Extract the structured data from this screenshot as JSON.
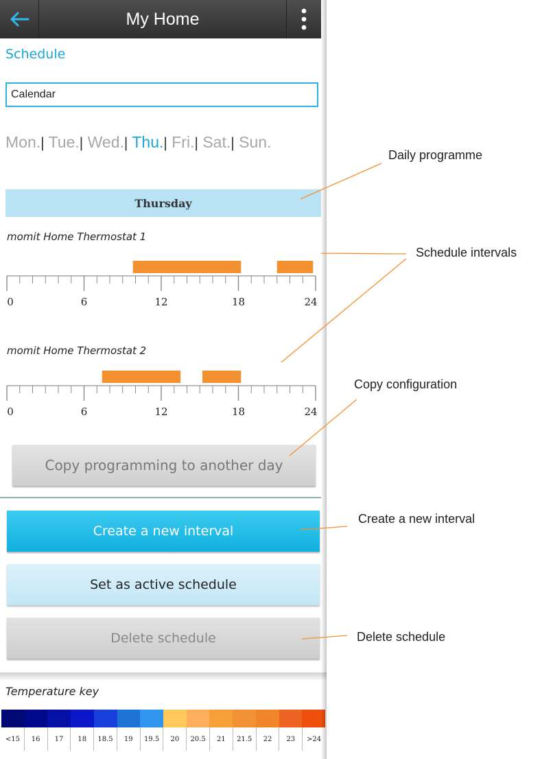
{
  "appbar": {
    "title": "My Home",
    "back_icon": "arrow-left-icon",
    "menu_icon": "more-vertical-icon"
  },
  "schedule": {
    "section_title": "Schedule",
    "calendar_value": "Calendar",
    "days": [
      "Mon.",
      "Tue.",
      "Wed.",
      "Thu.",
      "Fri.",
      "Sat.",
      "Sun."
    ],
    "separators": [
      "|",
      "|",
      "|",
      "|",
      "|",
      "|"
    ],
    "active_day": "Thu.",
    "selected_day_title": "Thursday"
  },
  "thermostats": [
    {
      "name": "momit Home Thermostat 1",
      "intervals": [
        [
          9.8,
          18.2
        ],
        [
          21.0,
          23.8
        ]
      ],
      "axis_labels": [
        "0",
        "6",
        "12",
        "18",
        "24"
      ]
    },
    {
      "name": "momit Home Thermostat 2",
      "intervals": [
        [
          7.4,
          13.5
        ],
        [
          15.2,
          18.2
        ]
      ],
      "axis_labels": [
        "0",
        "6",
        "12",
        "18",
        "24"
      ]
    }
  ],
  "buttons": {
    "copy": "Copy programming to another day",
    "create": "Create a new interval",
    "set_active": "Set as active schedule",
    "delete": "Delete schedule"
  },
  "temperature_key": {
    "title": "Temperature key",
    "labels": [
      "<15",
      "16",
      "17",
      "18",
      "18.5",
      "19",
      "19.5",
      "20",
      "20.5",
      "21",
      "21.5",
      "22",
      "23",
      ">24"
    ],
    "colors": [
      "#000873",
      "#00088c",
      "#0511a6",
      "#0a16c7",
      "#1640d9",
      "#1d73d6",
      "#2f95ee",
      "#ffc85a",
      "#ffaf5a",
      "#f7a03a",
      "#f39137",
      "#f1852a",
      "#ef6322",
      "#ee4f0c"
    ]
  },
  "annotations": {
    "daily_programme": "Daily programme",
    "schedule_intervals": "Schedule intervals",
    "copy_configuration": "Copy configuration",
    "create_interval": "Create a new interval",
    "delete_schedule": "Delete schedule"
  },
  "colors": {
    "accent": "#1aa6d8",
    "interval": "#f3902f",
    "callout_line": "#f3902f"
  }
}
